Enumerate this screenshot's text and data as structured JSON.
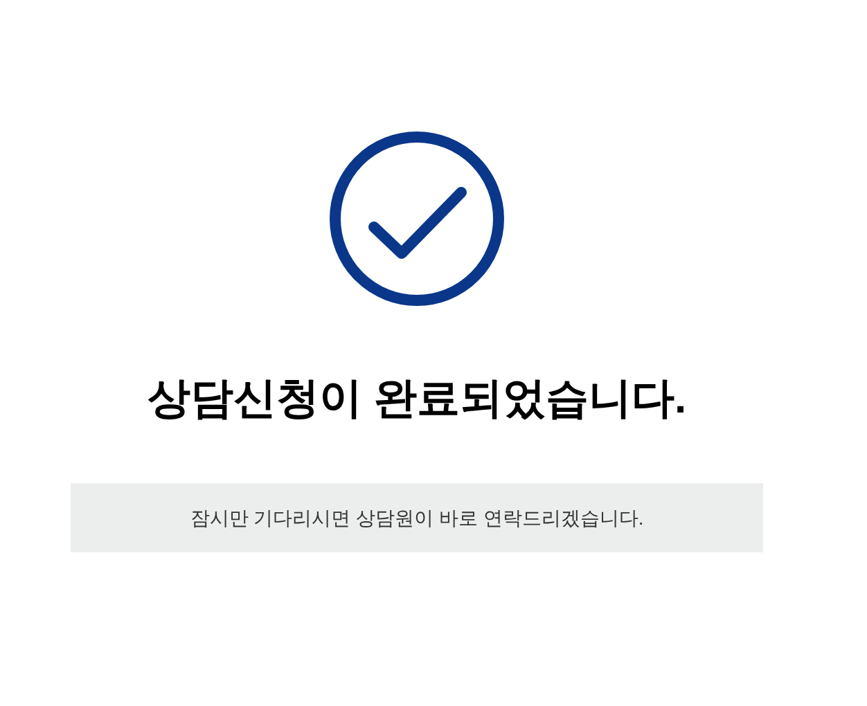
{
  "title": "상담신청이 완료되었습니다.",
  "message": "잠시만 기다리시면 상담원이 바로 연락드리겠습니다."
}
